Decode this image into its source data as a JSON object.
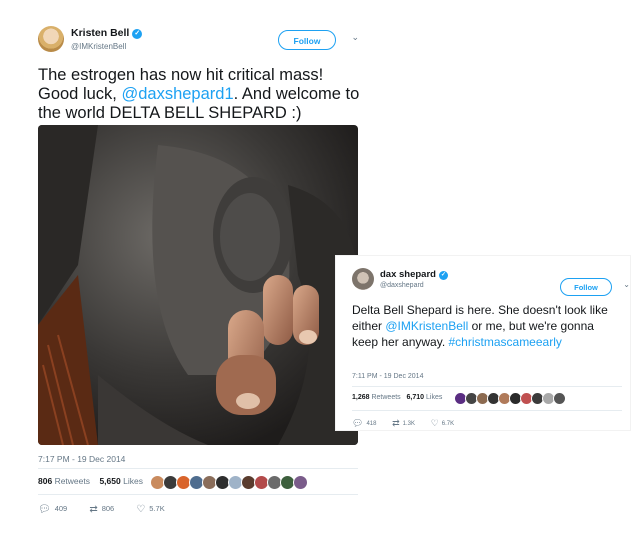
{
  "tweet1": {
    "name": "Kristen Bell",
    "handle": "@IMKristenBell",
    "follow_label": "Follow",
    "text_before": "The estrogen has now hit critical mass! Good luck, ",
    "mention": "@daxshepard1",
    "text_after": ".  And welcome to the world DELTA BELL SHEPARD :)",
    "timestamp": "7:17 PM - 19 Dec 2014",
    "retweets_count": "806",
    "retweets_label": "Retweets",
    "likes_count": "5,650",
    "likes_label": "Likes",
    "reply_count": "409",
    "retweet_count_small": "806",
    "like_count_small": "5.7K",
    "liker_colors": [
      "#c98b5e",
      "#3b3b3b",
      "#d9642b",
      "#4f6d8f",
      "#8a6d5a",
      "#2e2e2e",
      "#9fb3c8",
      "#5a3c2e",
      "#b34a4a",
      "#6b6b6b",
      "#3d5f3d",
      "#7a5c8a"
    ]
  },
  "tweet2": {
    "name": "dax shepard",
    "handle": "@daxshepard",
    "follow_label": "Follow",
    "text_before": "Delta Bell Shepard is here. She doesn't look like either ",
    "mention": "@IMKristenBell",
    "text_after": " or me, but we're gonna keep her anyway. ",
    "hashtag": "#christmascameearly",
    "timestamp": "7:11 PM - 19 Dec 2014",
    "retweets_count": "1,268",
    "retweets_label": "Retweets",
    "likes_count": "6,710",
    "likes_label": "Likes",
    "reply_count": "418",
    "retweet_count_small": "1.3K",
    "like_count_small": "6.7K",
    "liker_colors": [
      "#5a2d82",
      "#444444",
      "#8c6a50",
      "#333333",
      "#b07a5a",
      "#2a2a2a",
      "#c05050",
      "#3b3b3b",
      "#a8a8a8",
      "#555555"
    ]
  },
  "icons": {
    "verified": "verified-badge-icon",
    "chevron": "chevron-down-icon",
    "reply": "reply-icon",
    "retweet": "retweet-icon",
    "like": "heart-icon"
  }
}
